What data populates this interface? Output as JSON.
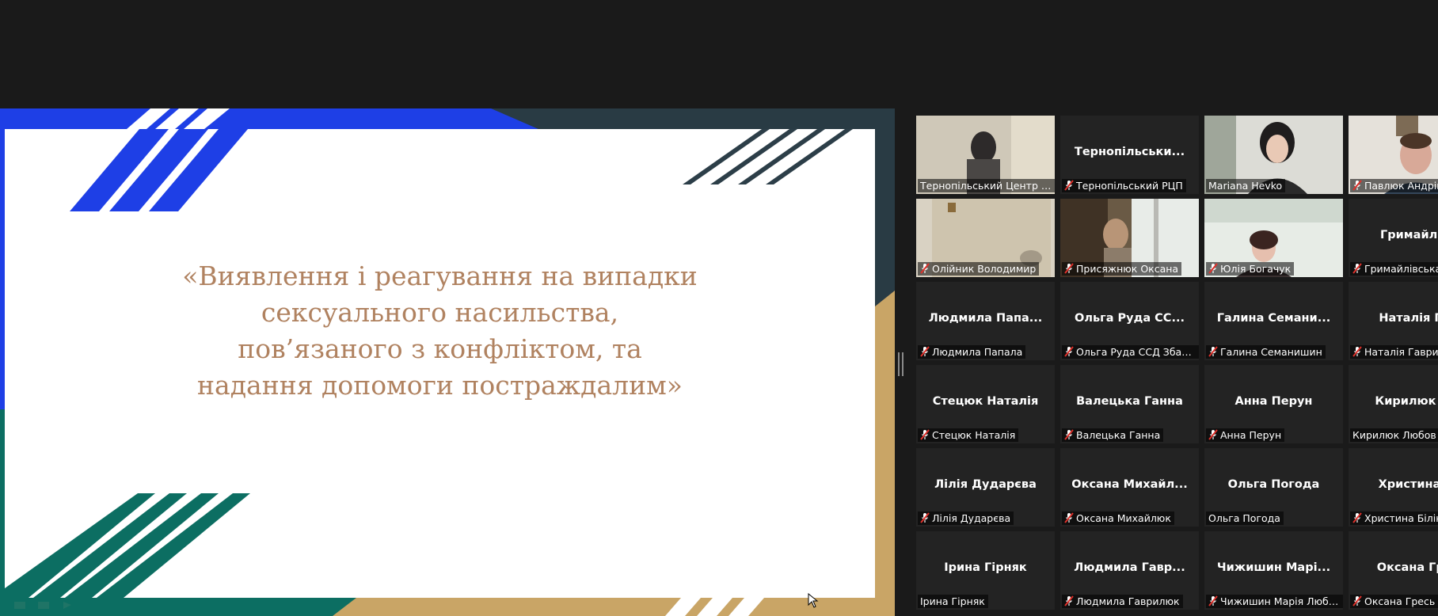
{
  "slide": {
    "title": "«Виявлення і реагування на випадки\nсексуального насильства,\nпов’язаного з конфліктом, та\nнадання допомоги постраждалим»"
  },
  "colors": {
    "slide_title": "#b08260",
    "stripe_blue": "#1e3fe6",
    "stripe_teal": "#0c6e62",
    "stripe_gold": "#c9a566",
    "active_speaker": "#b6d35e"
  },
  "participants": [
    {
      "label": "Тернопільський Центр ПК",
      "big_name": "",
      "video": true,
      "muted": false,
      "active": false
    },
    {
      "label": "Тернопільський РЦП",
      "big_name": "Тернопільськи...",
      "video": false,
      "muted": true,
      "active": false
    },
    {
      "label": "Mariana Hevko",
      "big_name": "",
      "video": true,
      "muted": false,
      "active": true
    },
    {
      "label": "Павлюк Андрій",
      "big_name": "",
      "video": true,
      "muted": true,
      "active": false
    },
    {
      "label": "Олійник Володимир",
      "big_name": "",
      "video": true,
      "muted": true,
      "active": false
    },
    {
      "label": "Присяжнюк Оксана",
      "big_name": "",
      "video": true,
      "muted": true,
      "active": false
    },
    {
      "label": "Юлія Богачук",
      "big_name": "",
      "video": true,
      "muted": true,
      "active": false
    },
    {
      "label": "Гримайлівська",
      "big_name": "Гримайлівс",
      "video": false,
      "muted": true,
      "active": false
    },
    {
      "label": "Людмила Папала",
      "big_name": "Людмила Папа...",
      "video": false,
      "muted": true,
      "active": false
    },
    {
      "label": "Ольга Руда ССД Збара...",
      "big_name": "Ольга Руда СС...",
      "video": false,
      "muted": true,
      "active": false
    },
    {
      "label": "Галина Семанишин",
      "big_name": "Галина Семани...",
      "video": false,
      "muted": true,
      "active": false
    },
    {
      "label": "Наталія Гаврил",
      "big_name": "Наталія Гав",
      "video": false,
      "muted": true,
      "active": false
    },
    {
      "label": "Стецюк Наталія",
      "big_name": "Стецюк Наталія",
      "video": false,
      "muted": true,
      "active": false
    },
    {
      "label": "Валецька Ганна",
      "big_name": "Валецька Ганна",
      "video": false,
      "muted": true,
      "active": false
    },
    {
      "label": "Анна Перун",
      "big_name": "Анна Перун",
      "video": false,
      "muted": true,
      "active": false
    },
    {
      "label": "Кирилюк Любов",
      "big_name": "Кирилюк Лю",
      "video": false,
      "muted": false,
      "active": false
    },
    {
      "label": "Лілія Дударєва",
      "big_name": "Лілія Дударєва",
      "video": false,
      "muted": true,
      "active": false
    },
    {
      "label": "Оксана Михайлюк",
      "big_name": "Оксана Михайл...",
      "video": false,
      "muted": true,
      "active": false
    },
    {
      "label": "Ольга Погода",
      "big_name": "Ольга Погода",
      "video": false,
      "muted": false,
      "active": false
    },
    {
      "label": "Христина Білінс",
      "big_name": "Христина Бі",
      "video": false,
      "muted": true,
      "active": false
    },
    {
      "label": "Ірина Гірняк",
      "big_name": "Ірина Гірняк",
      "video": false,
      "muted": false,
      "active": false
    },
    {
      "label": "Людмила Гаврилюк",
      "big_name": "Людмила Гавр...",
      "video": false,
      "muted": true,
      "active": false
    },
    {
      "label": "Чижишин Марія Любо...",
      "big_name": "Чижишин Марі...",
      "video": false,
      "muted": true,
      "active": false
    },
    {
      "label": "Оксана Гресь",
      "big_name": "Оксана Грес",
      "video": false,
      "muted": true,
      "active": false
    }
  ],
  "icons": {
    "muted": "mic-off-icon",
    "cursor": "mouse-cursor-icon"
  }
}
